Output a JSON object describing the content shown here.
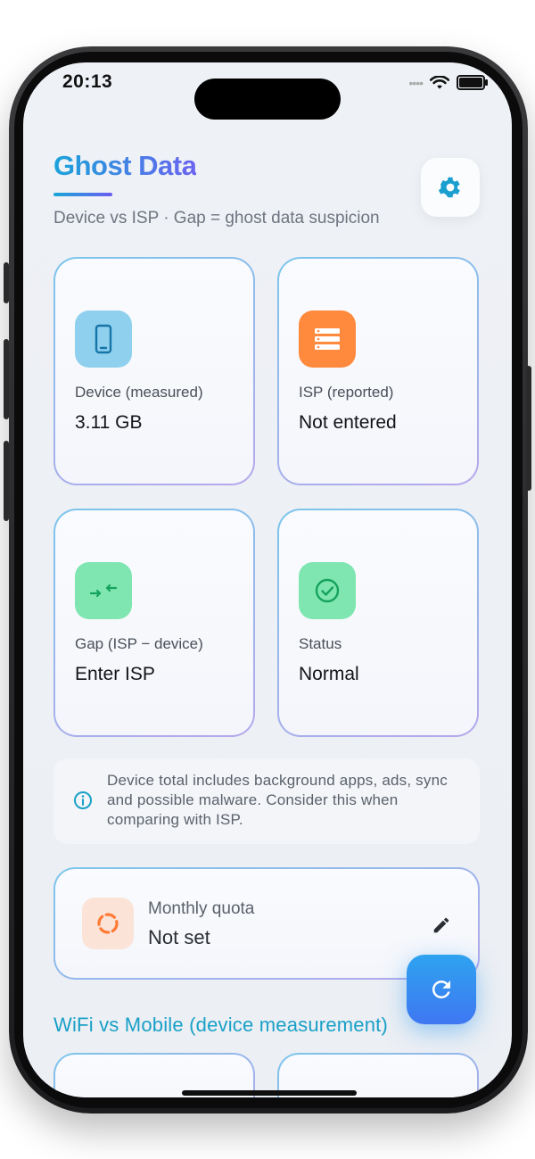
{
  "status_bar": {
    "time": "20:13"
  },
  "header": {
    "title": "Ghost Data",
    "subtitle": "Device vs ISP · Gap = ghost data suspicion"
  },
  "cards": [
    {
      "label": "Device (measured)",
      "value": "3.11 GB",
      "icon": "phone-icon",
      "color": "#8fd0ee"
    },
    {
      "label": "ISP (reported)",
      "value": "Not entered",
      "icon": "server-icon",
      "color": "#ff8a3d"
    },
    {
      "label": "Gap (ISP − device)",
      "value": "Enter ISP",
      "icon": "compare-arrows-icon",
      "color": "#7fe6b1"
    },
    {
      "label": "Status",
      "value": "Normal",
      "icon": "check-circle-icon",
      "color": "#7fe6b1"
    }
  ],
  "info": {
    "text": "Device total includes background apps, ads, sync and possible malware. Consider this when comparing with ISP."
  },
  "quota": {
    "label": "Monthly quota",
    "value": "Not set"
  },
  "section": {
    "title": "WiFi vs Mobile (device measurement)"
  },
  "colors": {
    "accent_start": "#1aa3d9",
    "accent_end": "#6a63f0",
    "section": "#1aa0c7"
  }
}
